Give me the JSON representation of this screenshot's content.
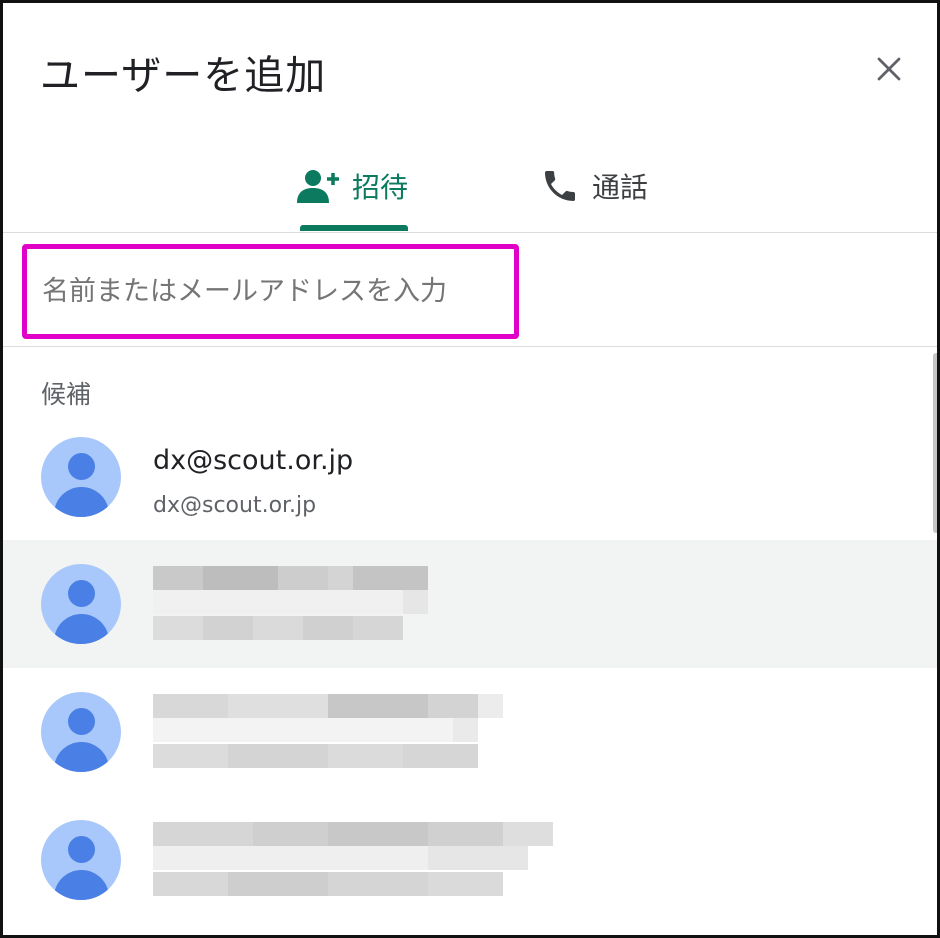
{
  "dialog": {
    "title": "ユーザーを追加",
    "close_icon": "close-icon"
  },
  "tabs": [
    {
      "label": "招待",
      "icon": "person-add-icon",
      "selected": true
    },
    {
      "label": "通話",
      "icon": "phone-icon",
      "selected": false
    }
  ],
  "search": {
    "placeholder": "名前またはメールアドレスを入力",
    "value": ""
  },
  "suggestions": {
    "label": "候補",
    "items": [
      {
        "name": "dx@scout.or.jp",
        "email": "dx@scout.or.jp",
        "redacted": false
      },
      {
        "name": "",
        "email": "",
        "redacted": true
      },
      {
        "name": "",
        "email": "",
        "redacted": true
      },
      {
        "name": "",
        "email": "",
        "redacted": true
      }
    ]
  },
  "colors": {
    "accent": "#0b7a5f",
    "highlight_border": "#e000c8",
    "avatar_bg": "#a8c7fa",
    "avatar_fg": "#4a7fe5",
    "hover_row": "#f1f4f3"
  }
}
